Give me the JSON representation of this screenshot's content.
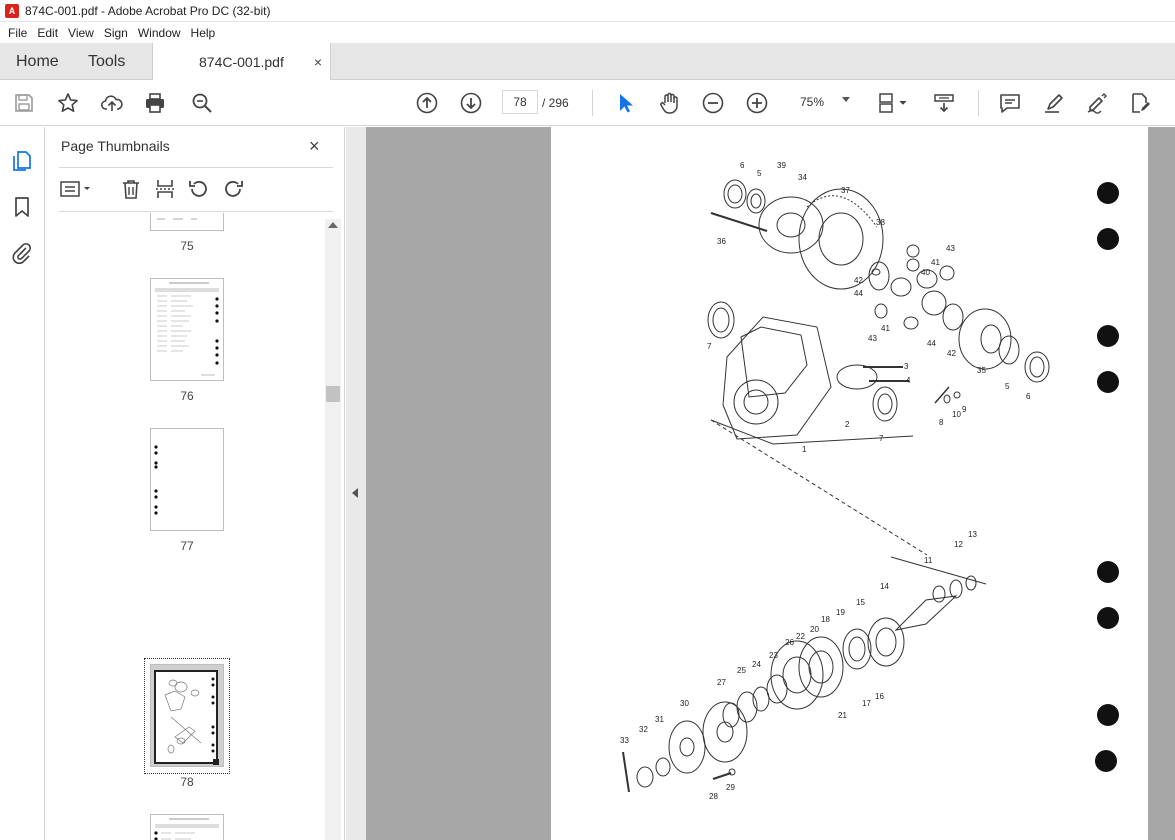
{
  "window": {
    "title": "874C-001.pdf - Adobe Acrobat Pro DC (32-bit)",
    "app_icon_glyph": "A"
  },
  "menubar": {
    "items": [
      "File",
      "Edit",
      "View",
      "Sign",
      "Window",
      "Help"
    ]
  },
  "tabs": {
    "home": "Home",
    "tools": "Tools",
    "document": "874C-001.pdf",
    "close_glyph": "×"
  },
  "toolbar": {
    "page_current": "78",
    "page_total": "/ 296",
    "zoom": "75%",
    "icons": [
      "save-icon",
      "star-icon",
      "upload-icon",
      "print-icon",
      "zoom-search-icon",
      "page-up-icon",
      "page-down-icon",
      "select-arrow-icon",
      "hand-icon",
      "zoom-out-icon",
      "zoom-in-icon",
      "fit-page-icon",
      "scroll-mode-icon",
      "comment-icon",
      "highlight-icon",
      "sign-icon",
      "edit-pdf-icon"
    ]
  },
  "panel": {
    "title": "Page Thumbnails",
    "close_glyph": "×",
    "thumbnails": [
      {
        "label": "75"
      },
      {
        "label": "76"
      },
      {
        "label": "77"
      },
      {
        "label": "78",
        "selected": true
      },
      {
        "label": ""
      }
    ]
  },
  "diagram": {
    "part_numbers_upper": [
      "6",
      "5",
      "39",
      "34",
      "37",
      "38",
      "36",
      "43",
      "41",
      "40",
      "42",
      "44",
      "7",
      "3",
      "4",
      "2",
      "7",
      "41",
      "43",
      "44",
      "42",
      "35",
      "5",
      "6",
      "8",
      "10",
      "9",
      "1"
    ],
    "part_numbers_lower": [
      "13",
      "12",
      "11",
      "14",
      "15",
      "19",
      "18",
      "20",
      "22",
      "26",
      "23",
      "24",
      "25",
      "27",
      "30",
      "31",
      "32",
      "33",
      "16",
      "17",
      "21",
      "28",
      "29"
    ]
  },
  "colors": {
    "accent": "#1473e6",
    "tab_bg": "#e6e6e6",
    "doc_bg": "#a7a7a7"
  }
}
